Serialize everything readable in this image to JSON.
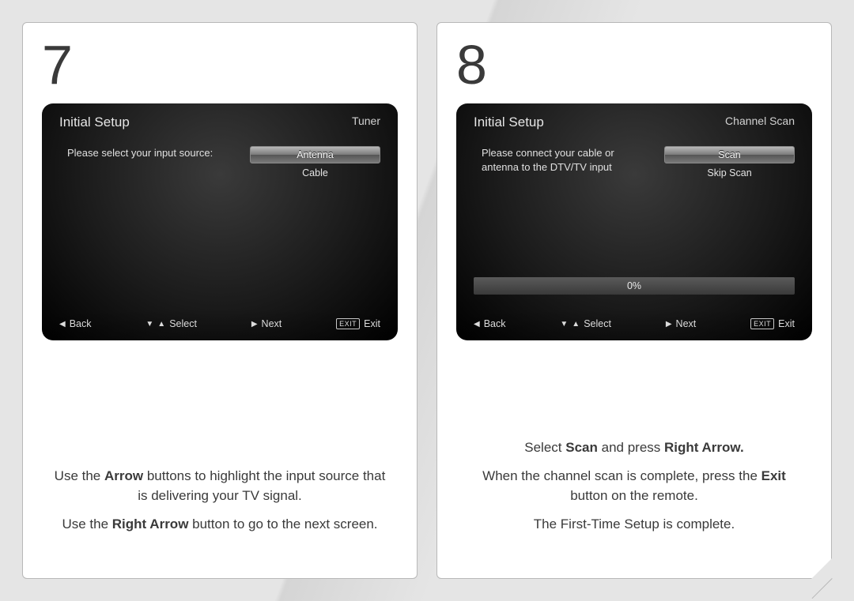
{
  "steps": [
    {
      "number": "7",
      "tv": {
        "title": "Initial Setup",
        "subtitle": "Tuner",
        "prompt": "Please select your input source:",
        "options": [
          "Antenna",
          "Cable"
        ],
        "selected": 0,
        "progress": null
      },
      "nav": {
        "back": "Back",
        "select": "Select",
        "next": "Next",
        "exit_box": "EXIT",
        "exit": "Exit"
      },
      "instructions": [
        {
          "pre": "Use the ",
          "b1": "Arrow",
          "mid": " buttons to highlight the input source that is delivering your TV signal.",
          "b2": "",
          "post": ""
        },
        {
          "pre": "Use the ",
          "b1": "Right Arrow",
          "mid": " button to go to the next screen.",
          "b2": "",
          "post": ""
        }
      ]
    },
    {
      "number": "8",
      "tv": {
        "title": "Initial Setup",
        "subtitle": "Channel Scan",
        "prompt": "Please connect your cable or antenna to the DTV/TV input",
        "options": [
          "Scan",
          "Skip Scan"
        ],
        "selected": 0,
        "progress": "0%"
      },
      "nav": {
        "back": "Back",
        "select": "Select",
        "next": "Next",
        "exit_box": "EXIT",
        "exit": "Exit"
      },
      "instructions": [
        {
          "pre": "Select ",
          "b1": "Scan",
          "mid": " and press ",
          "b2": "Right Arrow.",
          "post": ""
        },
        {
          "pre": "When the channel scan is complete, press the ",
          "b1": "Exit",
          "mid": " button on the remote.",
          "b2": "",
          "post": ""
        },
        {
          "pre": "The First-Time Setup is complete.",
          "b1": "",
          "mid": "",
          "b2": "",
          "post": ""
        }
      ]
    }
  ]
}
